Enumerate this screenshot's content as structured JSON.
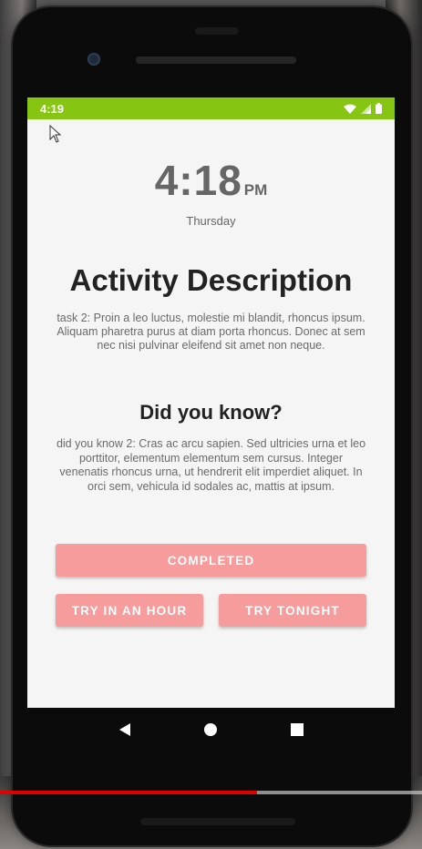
{
  "statusbar": {
    "time": "4:19"
  },
  "clock": {
    "time": "4:18",
    "ampm": "PM",
    "day": "Thursday"
  },
  "activity": {
    "title": "Activity Description",
    "text": "task 2: Proin a leo luctus, molestie mi blandit, rhoncus ipsum. Aliquam pharetra purus at diam porta rhoncus. Donec at sem nec nisi pulvinar eleifend sit amet non neque."
  },
  "didyouknow": {
    "title": "Did you know?",
    "text": "did you know 2:  Cras ac arcu sapien. Sed ultricies urna et leo porttitor, elementum elementum sem cursus. Integer venenatis rhoncus urna, ut hendrerit elit imperdiet aliquet. In orci sem, vehicula id sodales ac, mattis at ipsum."
  },
  "buttons": {
    "completed": "COMPLETED",
    "try_hour": "TRY IN AN HOUR",
    "try_tonight": "TRY TONIGHT"
  },
  "video": {
    "progress": 0.61
  },
  "colors": {
    "statusbar": "#86c511",
    "button": "#f79c9c",
    "progress": "#e00000"
  },
  "icons": [
    "wifi-icon",
    "cell-signal-icon",
    "battery-icon",
    "back-icon",
    "home-icon",
    "recents-icon",
    "cursor-icon"
  ]
}
